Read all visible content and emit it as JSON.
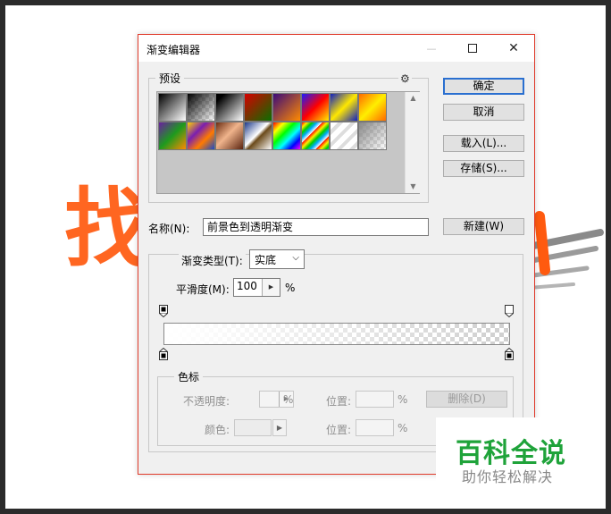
{
  "window": {
    "title": "渐变编辑器",
    "minimize": "—",
    "close": "✕"
  },
  "background": {
    "glyph_left": "找"
  },
  "presets": {
    "label": "预设",
    "settings_icon": "⚙",
    "swatches": [
      {
        "name": "black-white",
        "css": "linear-gradient(135deg,#000 0%,#fff 100%)"
      },
      {
        "name": "black-transparent",
        "css": "linear-gradient(135deg,#000 0%,rgba(0,0,0,0) 100%)"
      },
      {
        "name": "black-white-2",
        "css": "linear-gradient(135deg,#000 15%,#fff 100%)"
      },
      {
        "name": "red-green",
        "css": "linear-gradient(135deg,#d60000 0%,#0a6f00 100%)"
      },
      {
        "name": "violet-orange",
        "css": "linear-gradient(135deg,#3b0a7a 0%,#ff8a00 100%)"
      },
      {
        "name": "blue-red-yellow",
        "css": "linear-gradient(135deg,#1a1aff 0%,#ff0000 50%,#ffee00 100%)"
      },
      {
        "name": "blue-yellow-blue",
        "css": "linear-gradient(135deg,#1020c0 0%,#ffe800 50%,#1020c0 100%)"
      },
      {
        "name": "orange-yellow-orange",
        "css": "linear-gradient(135deg,#ff6a00 0%,#ffee00 50%,#ff6a00 100%)"
      },
      {
        "name": "violet-green-orange",
        "css": "linear-gradient(135deg,#6a1fa0 0%,#1e9a1e 50%,#ff8a00 100%)"
      },
      {
        "name": "yellow-violet-orange-blue",
        "css": "linear-gradient(135deg,#ffd200 0%,#7a1fb0 35%,#ff7a00 65%,#1a4ac8 100%)"
      },
      {
        "name": "copper",
        "css": "linear-gradient(135deg,#6b2d12 0%,#f0b48c 45%,#5a2410 100%)"
      },
      {
        "name": "chrome",
        "css": "linear-gradient(135deg,#1d3a8a 0%,#ffffff 45%,#6b4a1a 55%,#ffffff 100%)"
      },
      {
        "name": "spectrum",
        "css": "linear-gradient(135deg,#ff0000 0%,#ffff00 20%,#00ff00 40%,#00ffff 60%,#0000ff 80%,#ff00ff 100%)"
      },
      {
        "name": "transparent-rainbow",
        "css": "repeating-linear-gradient(135deg,#ff0000 0px,#ffee00 4px,#00cc00 8px,#00aaff 12px,#ffffff 16px)"
      },
      {
        "name": "transparent-stripes",
        "css": "repeating-linear-gradient(135deg,#ffffff 0px,#ffffff 6px,#dddddd 6px,#dddddd 10px)"
      },
      {
        "name": "neutral-density",
        "css": "linear-gradient(135deg,#888 0%,rgba(0,0,0,0) 100%)"
      }
    ]
  },
  "buttons": {
    "ok": "确定",
    "cancel": "取消",
    "load": "载入(L)...",
    "save": "存储(S)...",
    "new": "新建(W)",
    "delete": "删除(D)"
  },
  "name_field": {
    "label": "名称(N):",
    "value": "前景色到透明渐变"
  },
  "gradient": {
    "type_label": "渐变类型(T):",
    "type_value": "实底",
    "smoothness_label": "平滑度(M):",
    "smoothness_value": "100",
    "smoothness_unit": "%"
  },
  "color_stops": {
    "label": "色标",
    "opacity_label": "不透明度:",
    "opacity_unit": "%",
    "location_label": "位置:",
    "location_unit": "%",
    "color_label": "颜色:",
    "location2_label": "位置:",
    "location2_unit": "%"
  },
  "watermark": {
    "title": "百科全说",
    "subtitle": "助你轻松解决"
  }
}
